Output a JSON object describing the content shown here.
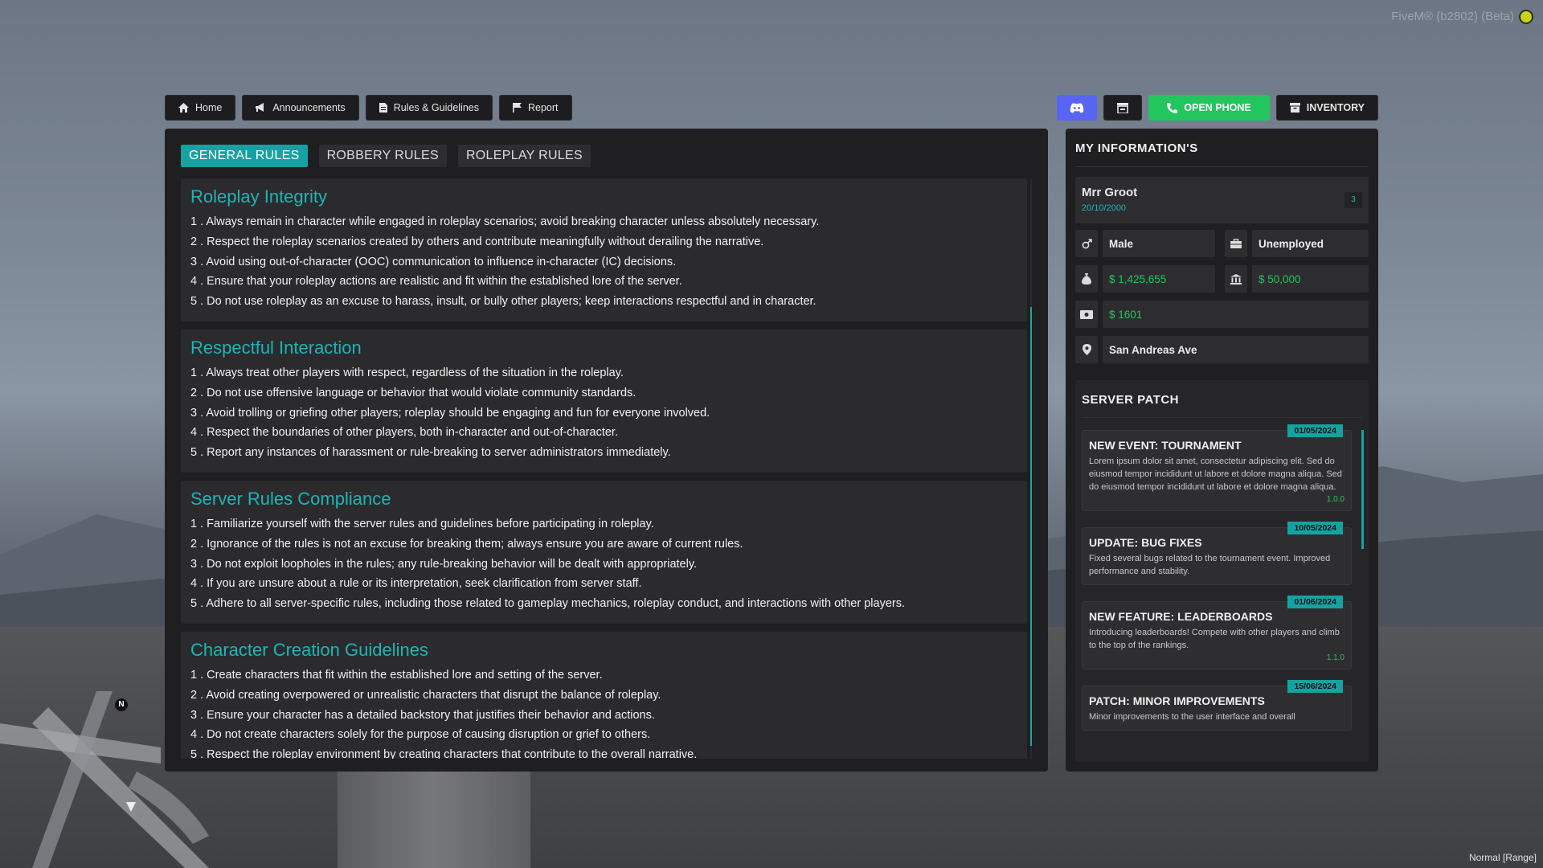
{
  "watermark": "FiveM® (b2802) (Beta)",
  "status_bar": "Normal [Range]",
  "minimap": {
    "north_label": "N"
  },
  "nav": {
    "home": "Home",
    "announcements": "Announcements",
    "rules": "Rules & Guidelines",
    "report": "Report",
    "open_phone": "OPEN PHONE",
    "inventory": "INVENTORY"
  },
  "tabs": [
    {
      "label": "GENERAL RULES",
      "active": true
    },
    {
      "label": "ROBBERY RULES",
      "active": false
    },
    {
      "label": "ROLEPLAY RULES",
      "active": false
    }
  ],
  "rules": [
    {
      "title": "Roleplay Integrity",
      "items": [
        "1 . Always remain in character while engaged in roleplay scenarios; avoid breaking character unless absolutely necessary.",
        "2 . Respect the roleplay scenarios created by others and contribute meaningfully without derailing the narrative.",
        "3 . Avoid using out-of-character (OOC) communication to influence in-character (IC) decisions.",
        "4 . Ensure that your roleplay actions are realistic and fit within the established lore of the server.",
        "5 . Do not use roleplay as an excuse to harass, insult, or bully other players; keep interactions respectful and in character."
      ]
    },
    {
      "title": "Respectful Interaction",
      "items": [
        "1 . Always treat other players with respect, regardless of the situation in the roleplay.",
        "2 . Do not use offensive language or behavior that would violate community standards.",
        "3 . Avoid trolling or griefing other players; roleplay should be engaging and fun for everyone involved.",
        "4 . Respect the boundaries of other players, both in-character and out-of-character.",
        "5 . Report any instances of harassment or rule-breaking to server administrators immediately."
      ]
    },
    {
      "title": "Server Rules Compliance",
      "items": [
        "1 . Familiarize yourself with the server rules and guidelines before participating in roleplay.",
        "2 . Ignorance of the rules is not an excuse for breaking them; always ensure you are aware of current rules.",
        "3 . Do not exploit loopholes in the rules; any rule-breaking behavior will be dealt with appropriately.",
        "4 . If you are unsure about a rule or its interpretation, seek clarification from server staff.",
        "5 . Adhere to all server-specific rules, including those related to gameplay mechanics, roleplay conduct, and interactions with other players."
      ]
    },
    {
      "title": "Character Creation Guidelines",
      "items": [
        "1 . Create characters that fit within the established lore and setting of the server.",
        "2 . Avoid creating overpowered or unrealistic characters that disrupt the balance of roleplay.",
        "3 . Ensure your character has a detailed backstory that justifies their behavior and actions.",
        "4 . Do not create characters solely for the purpose of causing disruption or grief to others.",
        "5 . Respect the roleplay environment by creating characters that contribute to the overall narrative."
      ]
    }
  ],
  "info": {
    "title": "MY INFORMATION'S",
    "name": "Mrr Groot",
    "dob": "20/10/2000",
    "id": "3",
    "gender": "Male",
    "job": "Unemployed",
    "cash": "$ 1,425,655",
    "bank": "$ 50,000",
    "black_money": "$ 1601",
    "location": "San Andreas Ave"
  },
  "patch": {
    "title": "SERVER PATCH",
    "entries": [
      {
        "date": "01/05/2024",
        "title": "NEW EVENT: TOURNAMENT",
        "body": "Lorem ipsum dolor sit amet, consectetur adipiscing elit. Sed do eiusmod tempor incididunt ut labore et dolore magna aliqua. Sed do eiusmod tempor incididunt ut labore et dolore magna aliqua.",
        "version": "1.0.0"
      },
      {
        "date": "10/05/2024",
        "title": "UPDATE: BUG FIXES",
        "body": "Fixed several bugs related to the tournament event. Improved performance and stability.",
        "version": ""
      },
      {
        "date": "01/06/2024",
        "title": "NEW FEATURE: LEADERBOARDS",
        "body": "Introducing leaderboards! Compete with other players and climb to the top of the rankings.",
        "version": "1.1.0"
      },
      {
        "date": "15/06/2024",
        "title": "PATCH: MINOR IMPROVEMENTS",
        "body": "Minor improvements to the user interface and overall",
        "version": ""
      }
    ]
  },
  "colors": {
    "accent": "#16a2a2",
    "money": "#22c55e",
    "discord": "#5865f2",
    "panel": "#1f1f21"
  }
}
